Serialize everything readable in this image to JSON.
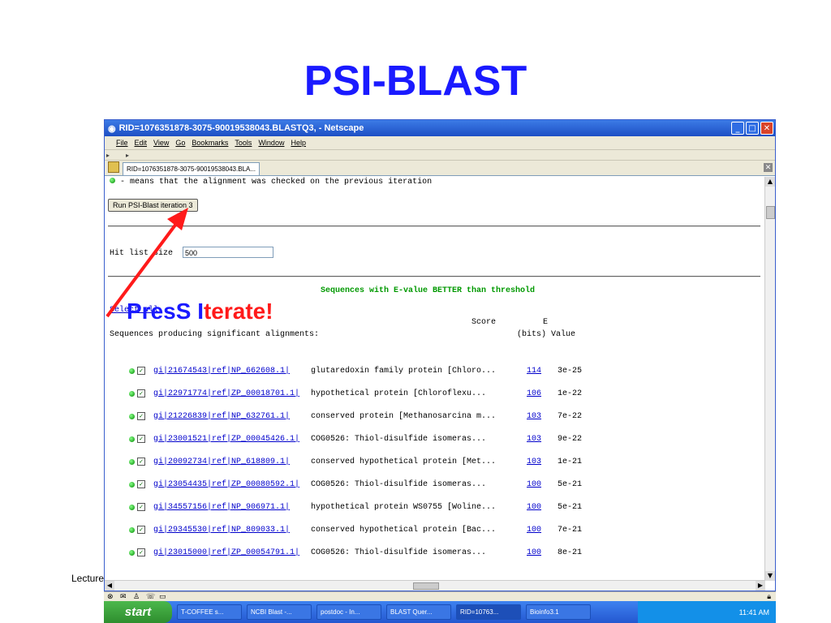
{
  "slide": {
    "title": "PSI-BLAST",
    "footer_text": "Lecture",
    "callout_part1": "PresS",
    "callout_part2": "I",
    "callout_part3": "terate!"
  },
  "window": {
    "title": "RID=1076351878-3075-90019538043.BLASTQ3, - Netscape",
    "menu": [
      "File",
      "Edit",
      "View",
      "Go",
      "Bookmarks",
      "Tools",
      "Window",
      "Help"
    ],
    "tab_label": "RID=1076351878-3075-90019538043.BLA..."
  },
  "page": {
    "note": "- means that the alignment was checked on the previous iteration",
    "run_button": "Run PSI-Blast iteration 3",
    "hit_list_label": "Hit list size",
    "hit_list_value": "500",
    "threshold_heading": "Sequences with E-value BETTER than threshold",
    "select_all_link": "Select all",
    "col_score": "Score",
    "col_e": "E",
    "col_bits": "(bits)",
    "col_value": "Value",
    "producing": "Sequences producing significant alignments:",
    "hits": [
      {
        "id": "gi|21674543|ref|NP_662608.1|",
        "desc": "glutaredoxin family protein [Chloro...",
        "score": "114",
        "e": "3e-25"
      },
      {
        "id": "gi|22971774|ref|ZP_00018701.1|",
        "desc": "hypothetical protein [Chloroflexu...",
        "score": "106",
        "e": "1e-22"
      },
      {
        "id": "gi|21226839|ref|NP_632761.1|",
        "desc": "conserved protein [Methanosarcina m...",
        "score": "103",
        "e": "7e-22"
      },
      {
        "id": "gi|23001521|ref|ZP_00045426.1|",
        "desc": "COG0526: Thiol-disulfide isomeras...",
        "score": "103",
        "e": "9e-22"
      },
      {
        "id": "gi|20092734|ref|NP_618809.1|",
        "desc": "conserved hypothetical protein [Met...",
        "score": "103",
        "e": "1e-21"
      },
      {
        "id": "gi|23054435|ref|ZP_00080592.1|",
        "desc": "COG0526: Thiol-disulfide isomeras...",
        "score": "100",
        "e": "5e-21"
      },
      {
        "id": "gi|34557156|ref|NP_906971.1|",
        "desc": "hypothetical protein WS0755 [Woline...",
        "score": "100",
        "e": "5e-21"
      },
      {
        "id": "gi|29345530|ref|NP_809033.1|",
        "desc": "conserved hypothetical protein [Bac...",
        "score": "100",
        "e": "7e-21"
      },
      {
        "id": "gi|23015000|ref|ZP_00054791.1|",
        "desc": "COG0526: Thiol-disulfide isomeras...",
        "score": "100",
        "e": "8e-21"
      }
    ]
  },
  "taskbar": {
    "start": "start",
    "items": [
      "T-COFFEE s...",
      "NCBI Blast -...",
      "postdoc - In...",
      "BLAST Quer...",
      "RID=10763...",
      "Bioinfo3.1"
    ],
    "clock": "11:41 AM"
  },
  "colors": {
    "title_blue": "#1a1aff",
    "callout_red": "#ff1a1a",
    "arrow_red": "#ff1a1a"
  }
}
